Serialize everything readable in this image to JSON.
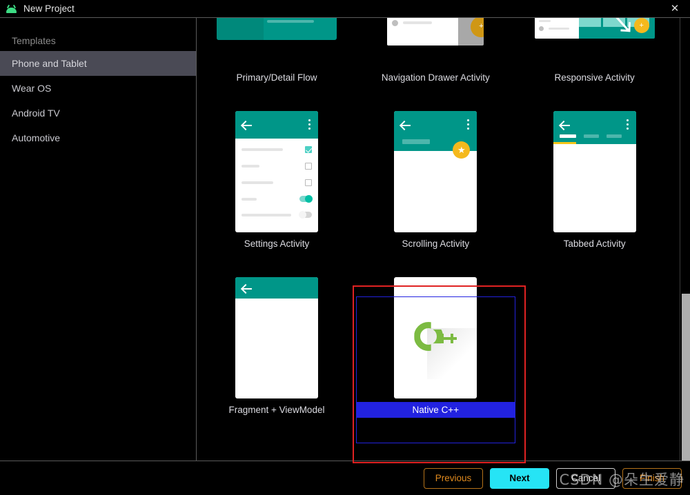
{
  "window": {
    "title": "New Project",
    "app_icon": "android-robot-icon",
    "close_label": "✕"
  },
  "sidebar": {
    "header": "Templates",
    "items": [
      {
        "label": "Phone and Tablet",
        "selected": true
      },
      {
        "label": "Wear OS",
        "selected": false
      },
      {
        "label": "Android TV",
        "selected": false
      },
      {
        "label": "Automotive",
        "selected": false
      }
    ]
  },
  "templates": [
    {
      "label": "Primary/Detail Flow",
      "kind": "primary-detail",
      "selected": false
    },
    {
      "label": "Navigation Drawer Activity",
      "kind": "nav-drawer",
      "selected": false
    },
    {
      "label": "Responsive Activity",
      "kind": "responsive",
      "selected": false
    },
    {
      "label": "Settings Activity",
      "kind": "settings",
      "selected": false
    },
    {
      "label": "Scrolling Activity",
      "kind": "scrolling",
      "selected": false
    },
    {
      "label": "Tabbed Activity",
      "kind": "tabbed",
      "selected": false
    },
    {
      "label": "Fragment + ViewModel",
      "kind": "fragment-viewmodel",
      "selected": false
    },
    {
      "label": "Native C++",
      "kind": "native-cpp",
      "selected": true
    },
    {
      "label": "",
      "kind": "blank",
      "selected": false
    }
  ],
  "footer": {
    "previous_label": "Previous",
    "next_label": "Next",
    "cancel_label": "Cancel",
    "finish_label": "Finish"
  },
  "watermark": "CSDN @朵生爱静",
  "colors": {
    "accent_cyan": "#26e4f5",
    "accent_orange": "#e08a1e",
    "selection_blue": "#2222e0",
    "annotation_red": "#e02222",
    "material_teal": "#009688",
    "fab_amber": "#f5b91d",
    "cpp_green": "#7cbb42",
    "sidebar_selected": "#4a4a55"
  }
}
